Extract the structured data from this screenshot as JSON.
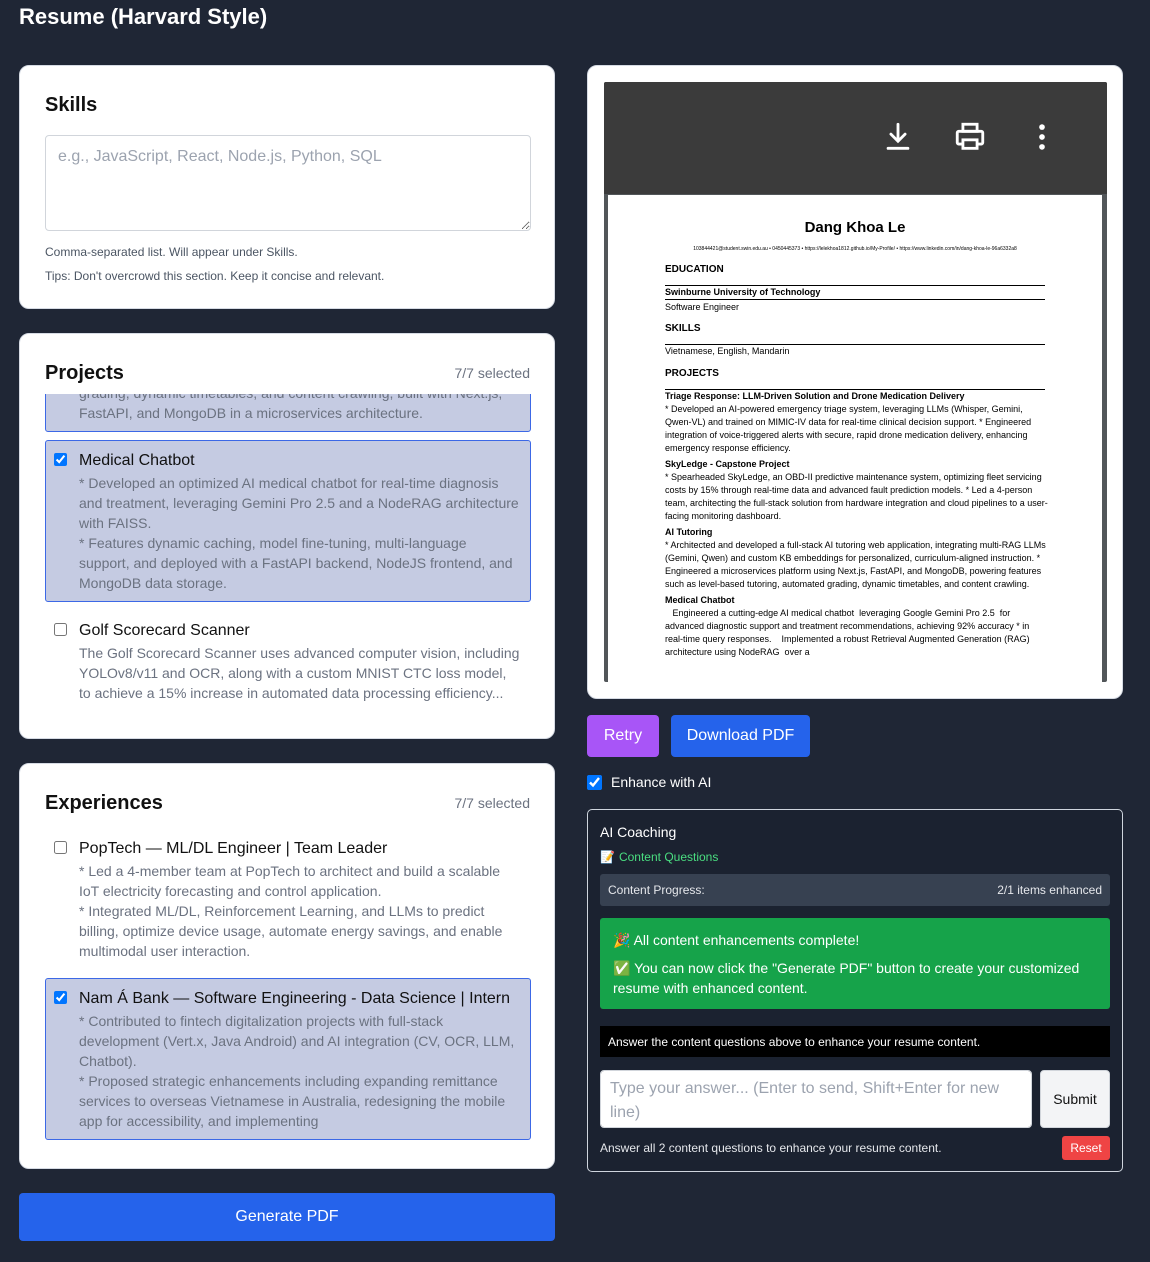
{
  "page_title": "Resume (Harvard Style)",
  "skills": {
    "heading": "Skills",
    "placeholder": "e.g., JavaScript, React, Node.js, Python, SQL",
    "hint1": "Comma-separated list. Will appear under Skills.",
    "hint2": "Tips: Don't overcrowd this section. Keep it concise and relevant."
  },
  "projects": {
    "heading": "Projects",
    "count": "7/7 selected",
    "items": [
      {
        "name": "",
        "checked": true,
        "desc": [
          "grading, dynamic timetables, and content crawling, built with Next.js, FastAPI, and MongoDB in a microservices architecture."
        ]
      },
      {
        "name": "Medical Chatbot",
        "checked": true,
        "desc": [
          "*   Developed an optimized AI medical chatbot for real-time diagnosis and treatment, leveraging Gemini Pro 2.5 and a NodeRAG architecture with FAISS.",
          "*   Features dynamic caching, model fine-tuning, multi-language support, and deployed with a FastAPI backend, NodeJS frontend, and MongoDB data storage."
        ]
      },
      {
        "name": "Golf Scorecard Scanner",
        "checked": false,
        "desc": [
          "The Golf Scorecard Scanner uses advanced computer vision, including YOLOv8/v11 and OCR, along with a custom MNIST CTC loss model, to achieve a 15% increase in automated data processing efficiency..."
        ]
      }
    ]
  },
  "experiences": {
    "heading": "Experiences",
    "count": "7/7 selected",
    "items": [
      {
        "name": "PopTech — ML/DL Engineer | Team Leader",
        "checked": false,
        "desc": [
          "*   Led a 4-member team at PopTech to architect and build a scalable IoT electricity forecasting and control application.",
          "*   Integrated ML/DL, Reinforcement Learning, and LLMs to predict billing, optimize device usage, automate energy savings, and enable multimodal user interaction."
        ]
      },
      {
        "name": "Nam Á Bank — Software Engineering - Data Science | Intern",
        "checked": true,
        "desc": [
          "*   Contributed to fintech digitalization projects with full-stack development (Vert.x, Java Android) and AI integration (CV, OCR, LLM, Chatbot).",
          "*   Proposed strategic enhancements including expanding remittance services to overseas Vietnamese in Australia, redesigning the mobile app for accessibility, and implementing"
        ]
      }
    ]
  },
  "generate_button": "Generate PDF",
  "pdf": {
    "toolbar_icons": [
      "download-icon",
      "print-icon",
      "more-vert-icon"
    ],
    "name": "Dang Khoa Le",
    "contact": "103844421@student.swin.edu.au • 0450445373 • https://lelekhoa1812.github.io/My-Profile/ • https://www.linkedin.com/in/dang-khoa-le-96a6332a8",
    "education_heading": "EDUCATION",
    "school": "Swinburne University of Technology",
    "degree": "Software Engineer",
    "skills_heading": "SKILLS",
    "skills_text": "Vietnamese, English, Mandarin",
    "projects_heading": "PROJECTS",
    "p1_title": "Triage Response: LLM-Driven Solution and Drone Medication Delivery",
    "p1_text": "* Developed an AI-powered emergency triage system, leveraging LLMs (Whisper, Gemini, Qwen-VL) and trained on MIMIC-IV data for real-time clinical decision support. * Engineered integration of voice-triggered alerts with secure, rapid drone medication delivery, enhancing emergency response efficiency.",
    "p2_title": "SkyLedge - Capstone Project",
    "p2_text": "* Spearheaded SkyLedge, an OBD-II predictive maintenance system, optimizing fleet servicing costs by 15% through real-time data and advanced fault prediction models. * Led a 4-person team, architecting the full-stack solution from hardware integration and cloud pipelines to a user-facing monitoring dashboard.",
    "p3_title": "AI Tutoring",
    "p3_text": "* Architected and developed a full-stack AI tutoring web application, integrating multi-RAG LLMs (Gemini, Qwen) and custom KB embeddings for personalized, curriculum-aligned instruction. * Engineered a microservices platform using Next.js, FastAPI, and MongoDB, powering features such as level-based tutoring, automated grading, dynamic timetables, and content crawling.",
    "p4_title": "Medical Chatbot",
    "p4_text": "   Engineered a cutting-edge AI medical chatbot  leveraging Google Gemini Pro 2.5  for advanced diagnostic support and treatment recommendations, achieving 92% accuracy * in real-time query responses.    Implemented a robust Retrieval Augmented Generation (RAG)  architecture using NodeRAG  over a"
  },
  "retry_button": "Retry",
  "download_button": "Download PDF",
  "enhance_label": "Enhance with AI",
  "coaching": {
    "title": "AI Coaching",
    "tab_icon": "memo-icon",
    "tab_label": "Content Questions",
    "progress_label": "Content Progress:",
    "progress_value": "2/1 items enhanced",
    "success_line1": "All content enhancements complete!",
    "success_line2": "You can now click the \"Generate PDF\" button to create your customized resume with enhanced content.",
    "info_bar": "Answer the content questions above to enhance your resume content.",
    "answer_placeholder": "Type your answer... (Enter to send, Shift+Enter for new line)",
    "submit_label": "Submit",
    "footer_text": "Answer all 2 content questions to enhance your resume content.",
    "reset_label": "Reset"
  },
  "colors": {
    "background": "#1f2635",
    "primary": "#2563eb",
    "retry": "#a855f7",
    "success": "#16a34a",
    "reset": "#ef4444",
    "selected_item": "#c5cbe2"
  }
}
